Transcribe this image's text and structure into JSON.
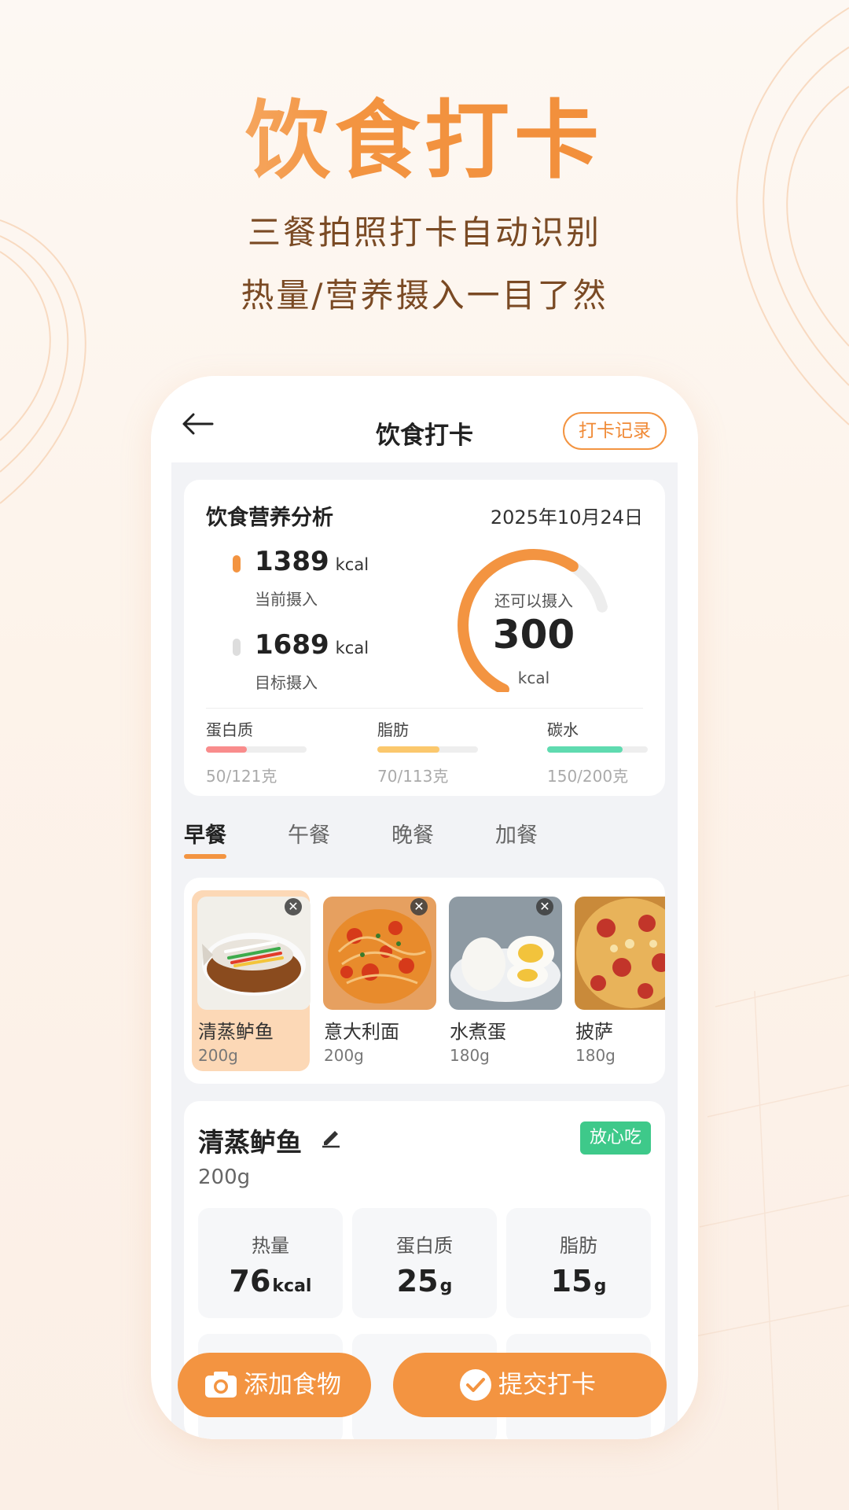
{
  "hero": {
    "title": "饮食打卡",
    "subtitle_1": "三餐拍照打卡自动识别",
    "subtitle_2": "热量/营养摄入一目了然"
  },
  "nav": {
    "title": "饮食打卡",
    "record_button": "打卡记录"
  },
  "nutrition": {
    "title": "饮食营养分析",
    "date": "2025年10月24日",
    "current": {
      "value": "1389",
      "unit": "kcal",
      "label": "当前摄入"
    },
    "target": {
      "value": "1689",
      "unit": "kcal",
      "label": "目标摄入"
    },
    "remaining": {
      "label": "还可以摄入",
      "value": "300",
      "unit": "kcal",
      "progress_fraction": 0.82
    },
    "macros": [
      {
        "name": "蛋白质",
        "value": "50/121克",
        "fraction": 0.41,
        "color": "#f98c8c"
      },
      {
        "name": "脂肪",
        "value": "70/113克",
        "fraction": 0.62,
        "color": "#fbc86d"
      },
      {
        "name": "碳水",
        "value": "150/200克",
        "fraction": 0.75,
        "color": "#5fdbb0"
      }
    ]
  },
  "meal_tabs": [
    "早餐",
    "午餐",
    "晚餐",
    "加餐"
  ],
  "foods": [
    {
      "name": "清蒸鲈鱼",
      "weight": "200g"
    },
    {
      "name": "意大利面",
      "weight": "200g"
    },
    {
      "name": "水煮蛋",
      "weight": "180g"
    },
    {
      "name": "披萨",
      "weight": "180g"
    }
  ],
  "detail": {
    "name": "清蒸鲈鱼",
    "weight": "200g",
    "badge": "放心吃",
    "boxes": [
      {
        "label": "热量",
        "value": "76",
        "unit": "kcal"
      },
      {
        "label": "蛋白质",
        "value": "25",
        "unit": "g"
      },
      {
        "label": "脂肪",
        "value": "15",
        "unit": "g"
      }
    ]
  },
  "buttons": {
    "add_food": "添加食物",
    "submit": "提交打卡"
  },
  "colors": {
    "accent": "#f39441",
    "safe": "#3ec98a"
  }
}
